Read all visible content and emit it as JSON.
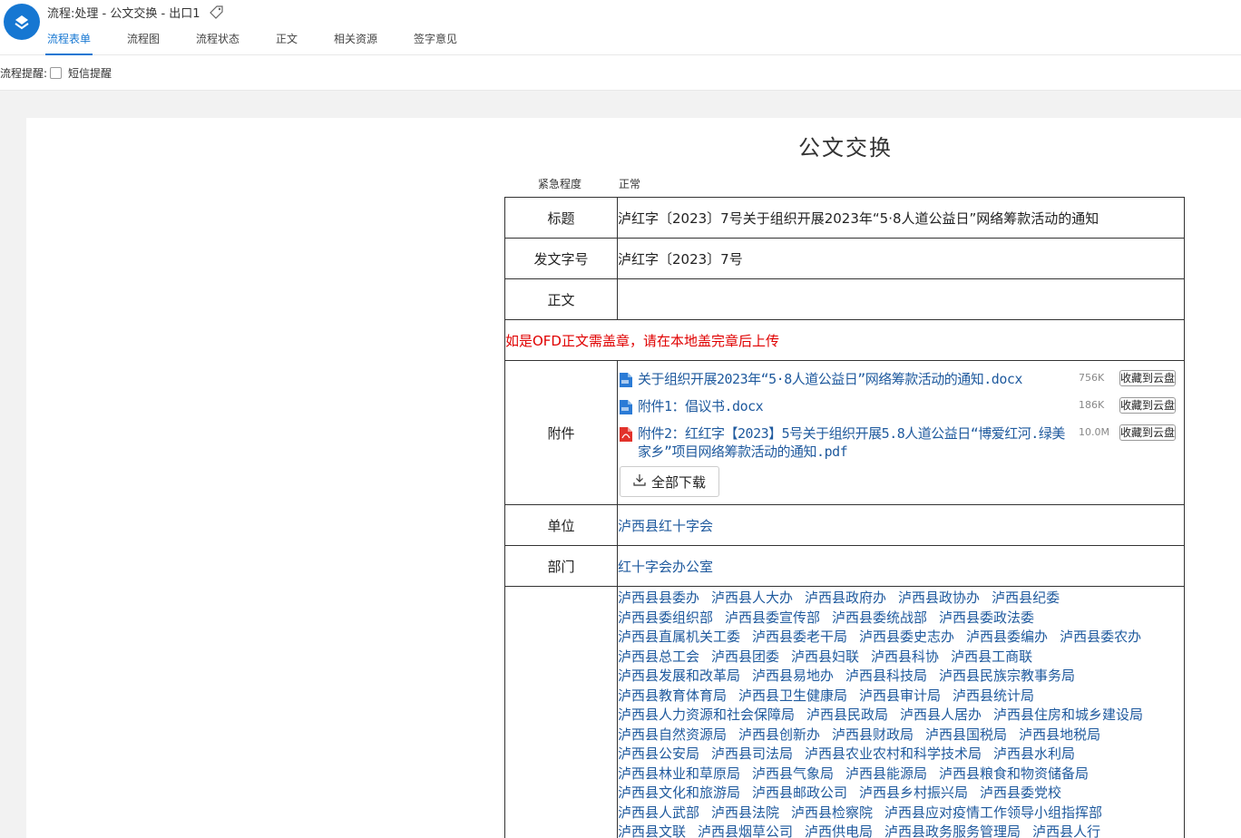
{
  "header": {
    "title": "流程:处理 - 公文交换 - 出口1",
    "tabs": [
      {
        "label": "流程表单",
        "active": true
      },
      {
        "label": "流程图",
        "active": false
      },
      {
        "label": "流程状态",
        "active": false
      },
      {
        "label": "正文",
        "active": false
      },
      {
        "label": "相关资源",
        "active": false
      },
      {
        "label": "签字意见",
        "active": false
      }
    ]
  },
  "reminder": {
    "label": "流程提醒:",
    "sms_label": "短信提醒",
    "sms_checked": false
  },
  "form": {
    "title": "公文交换",
    "urgency_label": "紧急程度",
    "urgency_value": "正常",
    "rows": {
      "title_label": "标题",
      "title_value": "泸红字〔2023〕7号关于组织开展2023年“5·8人道公益日”网络筹款活动的通知",
      "docno_label": "发文字号",
      "docno_value": "泸红字〔2023〕7号",
      "body_label": "正文",
      "notice": "如是OFD正文需盖章，请在本地盖完章后上传",
      "attach_label": "附件",
      "unit_label": "单位",
      "unit_value": "泸西县红十字会",
      "dept_label": "部门",
      "dept_value": "红十字会办公室"
    },
    "attachments": [
      {
        "name": "关于组织开展2023年“5·8人道公益日”网络筹款活动的通知.docx",
        "size": "756K",
        "type": "word",
        "button": "收藏到云盘"
      },
      {
        "name": "附件1：倡议书.docx",
        "size": "186K",
        "type": "word",
        "button": "收藏到云盘"
      },
      {
        "name": "附件2：红红字【2023】5号关于组织开展5.8人道公益日“博爱红河.绿美家乡”项目网络筹款活动的通知.pdf",
        "size": "10.0M",
        "type": "pdf",
        "button": "收藏到云盘"
      }
    ],
    "download_all": "全部下载",
    "recipients": [
      [
        "泸西县县委办",
        "泸西县人大办",
        "泸西县政府办",
        "泸西县政协办",
        "泸西县纪委"
      ],
      [
        "泸西县委组织部",
        "泸西县委宣传部",
        "泸西县委统战部",
        "泸西县委政法委"
      ],
      [
        "泸西县直属机关工委",
        "泸西县委老干局",
        "泸西县委史志办",
        "泸西县委编办",
        "泸西县委农办"
      ],
      [
        "泸西县总工会",
        "泸西县团委",
        "泸西县妇联",
        "泸西县科协",
        "泸西县工商联"
      ],
      [
        "泸西县发展和改革局",
        "泸西县易地办",
        "泸西县科技局",
        "泸西县民族宗教事务局"
      ],
      [
        "泸西县教育体育局",
        "泸西县卫生健康局",
        "泸西县审计局",
        "泸西县统计局"
      ],
      [
        "泸西县人力资源和社会保障局",
        "泸西县民政局",
        "泸西县人居办",
        "泸西县住房和城乡建设局"
      ],
      [
        "泸西县自然资源局",
        "泸西县创新办",
        "泸西县财政局",
        "泸西县国税局",
        "泸西县地税局"
      ],
      [
        "泸西县公安局",
        "泸西县司法局",
        "泸西县农业农村和科学技术局",
        "泸西县水利局"
      ],
      [
        "泸西县林业和草原局",
        "泸西县气象局",
        "泸西县能源局",
        "泸西县粮食和物资储备局"
      ],
      [
        "泸西县文化和旅游局",
        "泸西县邮政公司",
        "泸西县乡村振兴局",
        "泸西县委党校"
      ],
      [
        "泸西县人武部",
        "泸西县法院",
        "泸西县检察院",
        "泸西县应对疫情工作领导小组指挥部"
      ],
      [
        "泸西县文联",
        "泸西县烟草公司",
        "泸西供电局",
        "泸西县政务服务管理局",
        "泸西县人行"
      ]
    ]
  },
  "colors": {
    "accent": "#1677d2",
    "link": "#1f5a9e",
    "notice": "#e00000"
  }
}
